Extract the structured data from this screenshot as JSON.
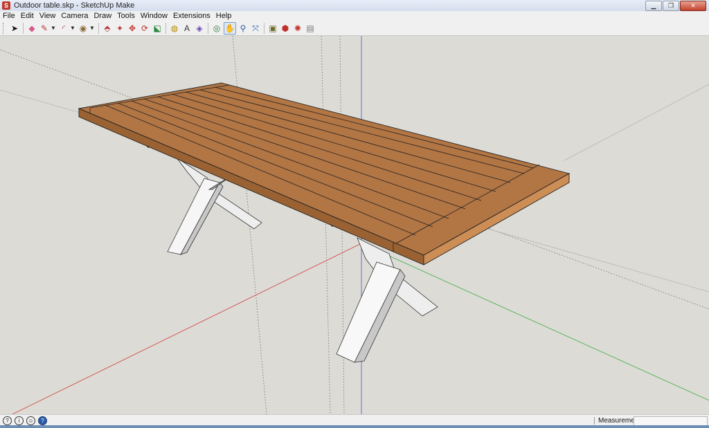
{
  "window": {
    "title": "Outdoor table.skp - SketchUp Make",
    "app_icon": "sketchup-icon",
    "buttons": [
      "minimize-icon",
      "maximize-icon",
      "close-icon"
    ]
  },
  "menu": {
    "items": [
      "File",
      "Edit",
      "View",
      "Camera",
      "Draw",
      "Tools",
      "Window",
      "Extensions",
      "Help"
    ]
  },
  "toolbar": {
    "tools": [
      "select",
      "eraser",
      "pencil-line",
      "arc",
      "shapes",
      "push-pull",
      "move",
      "rotate",
      "scale",
      "offset",
      "tape-measure",
      "text",
      "paint-bucket",
      "orbit",
      "pan",
      "zoom",
      "zoom-extents",
      "components",
      "warehouse",
      "extension-warehouse",
      "layout"
    ],
    "active_tool": "pan"
  },
  "colors": {
    "wood_top": "#b27544",
    "wood_front": "#9a6232",
    "wood_end": "#cd8e56",
    "leg_face": "#f6f6f6",
    "leg_shade": "#c5c5c5",
    "sky": "#dcdbd6",
    "axis_red": "#d24a4a",
    "axis_green": "#4fb24f",
    "axis_blue": "#5a62d2"
  },
  "status": {
    "measurements_label": "Measurements",
    "measurements_value": ""
  }
}
